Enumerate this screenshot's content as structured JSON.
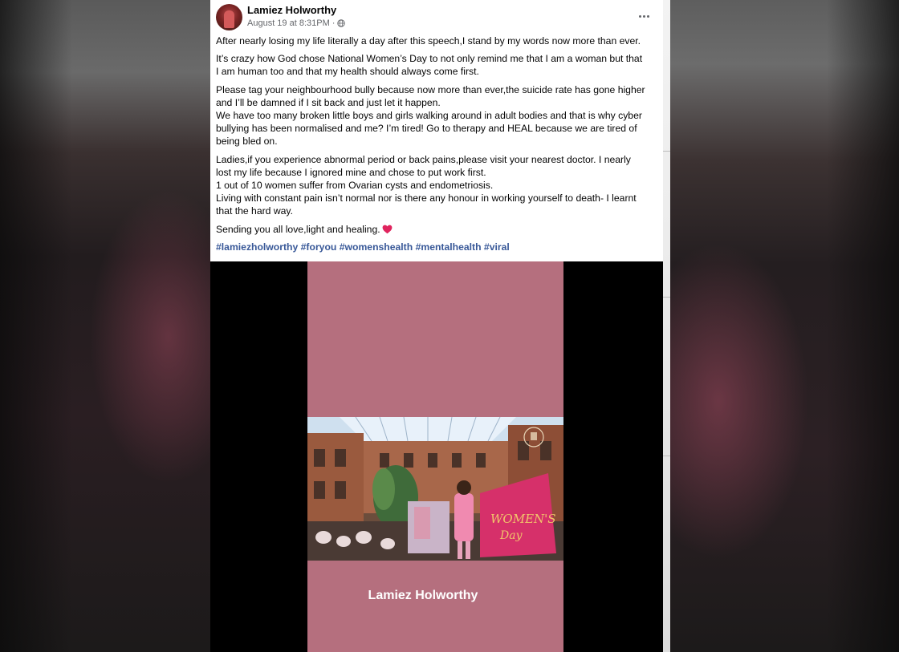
{
  "post": {
    "author": "Lamiez Holworthy",
    "timestamp": "August 19 at 8:31PM",
    "separator": "·",
    "privacy_icon": "globe-icon",
    "menu_icon": "more-options-icon",
    "paragraphs": [
      [
        "After nearly losing my life literally a day after this speech,I stand by my words now more than ever."
      ],
      [
        "It’s crazy how God chose National Women’s Day to not only remind me that I am a woman but that",
        "I am human too and that my health should always come first."
      ],
      [
        "Please tag your neighbourhood bully because now more than ever,the suicide rate has gone higher",
        "and I’ll be damned if I sit back and just let it happen.",
        "We have too many broken little boys and girls walking around in adult bodies and that is why cyber",
        "bullying has been normalised and me? I’m tired! Go to therapy and HEAL because we are tired of",
        "being bled on."
      ],
      [
        "Ladies,if you experience abnormal period or back pains,please visit your nearest doctor. I nearly",
        "lost my life because I ignored mine and chose to put work first.",
        "1 out of 10 women suffer from Ovarian cysts and endometriosis.",
        "Living with constant pain isn’t normal nor is there any honour in working yourself to death- I learnt",
        "that the hard way."
      ],
      [
        "Sending you all love,light and healing."
      ]
    ],
    "closing_emoji": "heart-icon",
    "hashtags": [
      "#lamiezholworthy",
      "#foryou",
      "#womenshealth",
      "#mentalhealth",
      "#viral"
    ]
  },
  "video": {
    "caption": "Lamiez Holworthy",
    "photo_banner": "WOMEN'S Day",
    "frame_color": "#b56f7e"
  },
  "colors": {
    "link": "#385898",
    "text": "#050505",
    "meta": "#65676b",
    "heart": "#e0245e"
  }
}
